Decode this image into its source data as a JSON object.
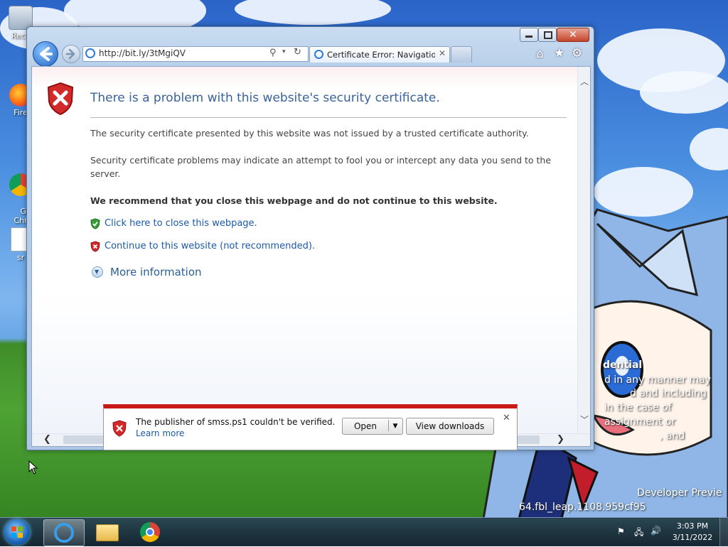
{
  "desktop": {
    "icons": [
      {
        "label": "Recy"
      },
      {
        "label": "Fire"
      },
      {
        "label": "Go\nChr"
      },
      {
        "label": "sr"
      }
    ],
    "watermark_lines": [
      "dential",
      "d in any manner may",
      "d and including",
      "in the case of",
      "assignment or",
      ", and",
      "Developer Previe",
      "64.fbl_leap.1108.959cf95"
    ]
  },
  "ie": {
    "address": "http://bit.ly/3tMgiQV",
    "tab_title": "Certificate Error: Navigation...",
    "heading": "There is a problem with this website's security certificate.",
    "para1": "The security certificate presented by this website was not issued by a trusted certificate authority.",
    "para2": "Security certificate problems may indicate an attempt to fool you or intercept any data you send to the server.",
    "recommend": "We recommend that you close this webpage and do not continue to this website.",
    "close_link": "Click here to close this webpage.",
    "continue_link": "Continue to this website (not recommended).",
    "more_info": "More information"
  },
  "download_bar": {
    "message": "The publisher of smss.ps1 couldn't be verified.",
    "learn_more": "Learn more",
    "open_label": "Open",
    "view_downloads_label": "View downloads"
  },
  "taskbar": {
    "time": "3:03 PM",
    "date": "3/11/2022"
  },
  "colors": {
    "accent_red": "#c81818",
    "link_blue": "#1e5aa6",
    "heading_blue": "#3b6298"
  }
}
